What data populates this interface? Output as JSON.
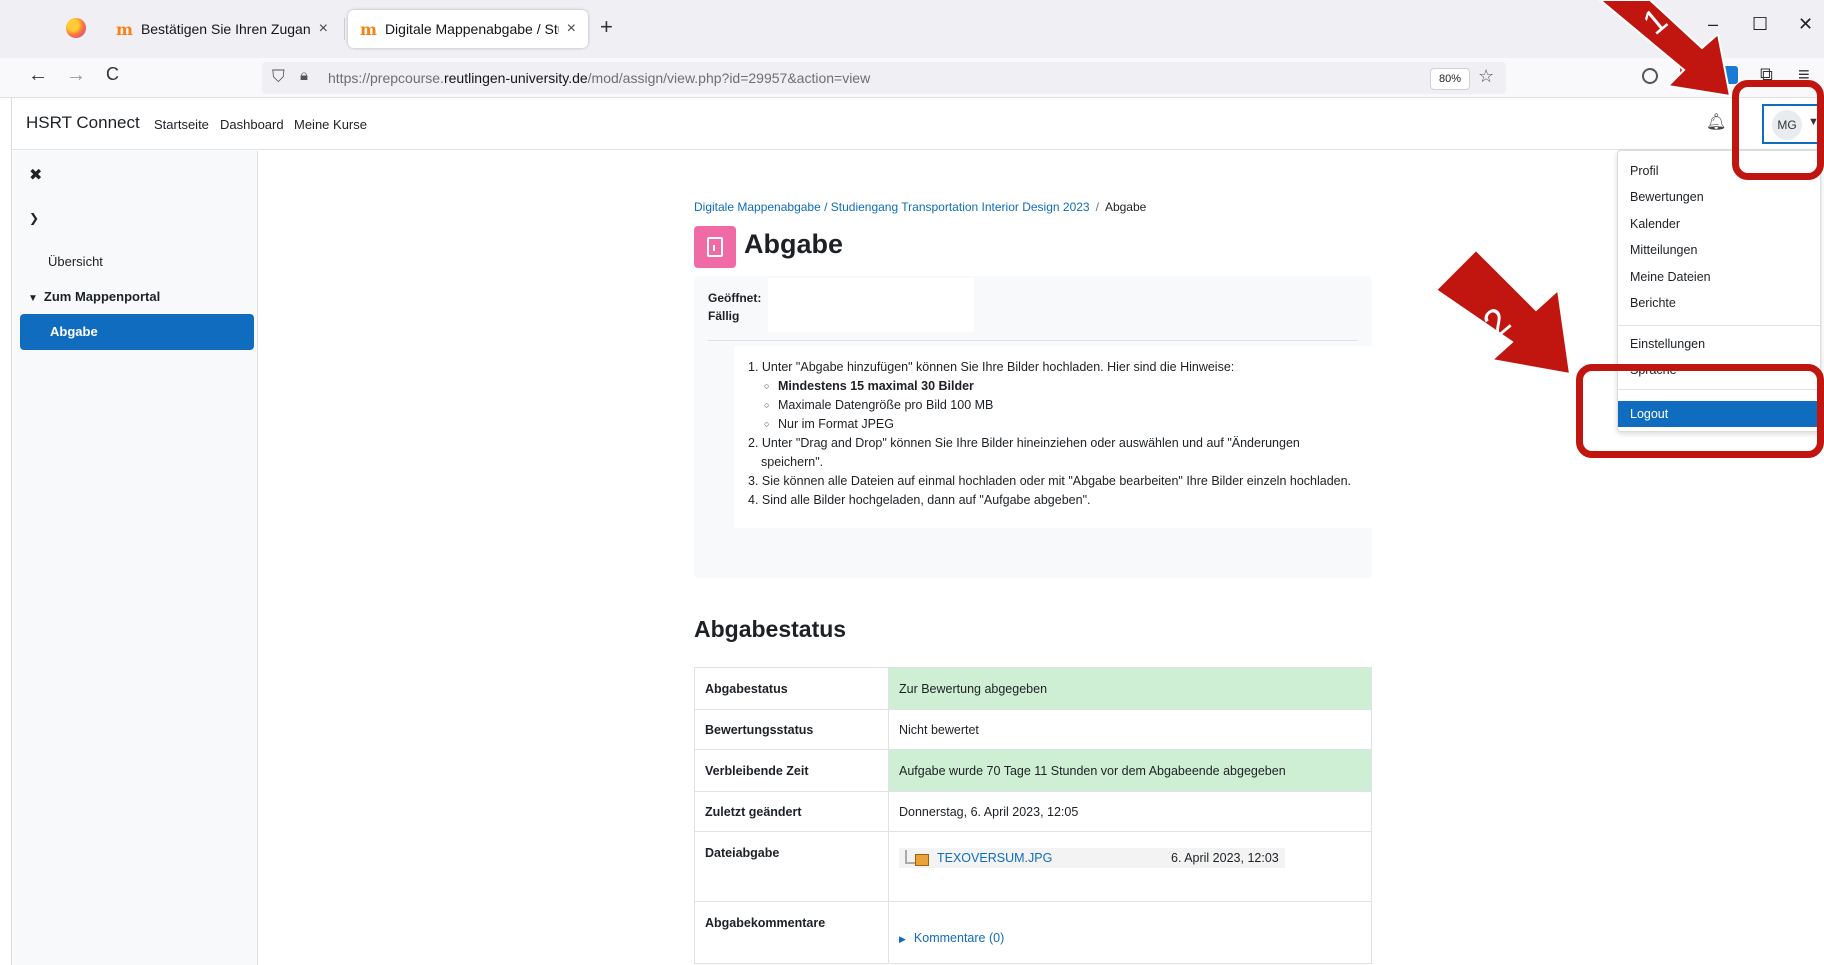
{
  "browser": {
    "tabs": [
      {
        "title": "Bestätigen Sie Ihren Zugang",
        "close": "×"
      },
      {
        "title": "Digitale Mappenabgabe / Studi",
        "close": "×"
      }
    ],
    "new_tab": "+",
    "window_controls": {
      "minimize": "–",
      "maximize": "☐",
      "close": "✕"
    },
    "nav": {
      "back": "←",
      "forward": "→",
      "reload": "C"
    },
    "url_prefix": "https://prepcourse.",
    "url_domain": "reutlingen-university.de",
    "url_path": "/mod/assign/view.php?id=29957&action=view",
    "zoom": "80%",
    "menu_icon": "≡"
  },
  "header": {
    "brand": "HSRT Connect",
    "nav": [
      "Startseite",
      "Dashboard",
      "Meine Kurse"
    ],
    "avatar": "MG"
  },
  "sidebar": {
    "items": [
      "Übersicht",
      "Zum Mappenportal",
      "Abgabe"
    ]
  },
  "main": {
    "breadcrumb": {
      "course": "Digitale Mappenabgabe / Studiengang Transportation Interior Design 2023",
      "sep": "/",
      "current": "Abgabe"
    },
    "title": "Abgabe",
    "dates": {
      "opened": "Geöffnet:",
      "due": "Fällig"
    },
    "instructions": {
      "l1": "1. Unter \"Abgabe hinzufügen\" können Sie Ihre Bilder hochladen. Hier sind die Hinweise:",
      "l1a": "Mindestens 15 maximal 30 Bilder",
      "l1b": "Maximale Datengröße pro Bild 100 MB",
      "l1c": "Nur im Format JPEG",
      "l2a": "2. Unter \"Drag and Drop\" können Sie Ihre Bilder hineinziehen oder auswählen und auf \"Änderungen",
      "l2b": "speichern\".",
      "l3": "3. Sie können alle Dateien auf einmal hochladen oder mit \"Abgabe bearbeiten\" Ihre Bilder einzeln hochladen.",
      "l4": "4. Sind alle Bilder hochgeladen, dann auf \"Aufgabe abgeben\"."
    },
    "status_title": "Abgabestatus",
    "status_rows": [
      {
        "label": "Abgabestatus",
        "value": "Zur Bewertung abgegeben"
      },
      {
        "label": "Bewertungsstatus",
        "value": "Nicht bewertet"
      },
      {
        "label": "Verbleibende Zeit",
        "value": "Aufgabe wurde 70 Tage 11 Stunden vor dem Abgabeende abgegeben"
      },
      {
        "label": "Zuletzt geändert",
        "value": "Donnerstag, 6. April 2023, 12:05"
      },
      {
        "label": "Dateiabgabe",
        "file": "TEXOVERSUM.JPG",
        "date": "6. April 2023, 12:03"
      },
      {
        "label": "Abgabekommentare",
        "value": "Kommentare (0)"
      }
    ]
  },
  "dropdown": {
    "items": [
      "Profil",
      "Bewertungen",
      "Kalender",
      "Mitteilungen",
      "Meine Dateien",
      "Berichte",
      "Einstellungen",
      "Sprache"
    ],
    "logout": "Logout"
  },
  "annotations": {
    "step1": "1",
    "step2": "2",
    "color": "#c0160f"
  }
}
